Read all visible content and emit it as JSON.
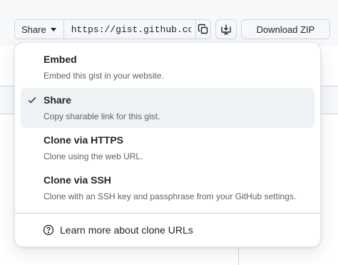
{
  "toolbar": {
    "share_label": "Share",
    "url_value": "https://gist.github.com/",
    "download_zip_label": "Download ZIP"
  },
  "menu": {
    "items": [
      {
        "title": "Embed",
        "description": "Embed this gist in your website.",
        "selected": false
      },
      {
        "title": "Share",
        "description": "Copy sharable link for this gist.",
        "selected": true
      },
      {
        "title": "Clone via HTTPS",
        "description": "Clone using the web URL.",
        "selected": false
      },
      {
        "title": "Clone via SSH",
        "description": "Clone with an SSH key and passphrase from your GitHub settings.",
        "selected": false
      }
    ],
    "footer_label": "Learn more about clone URLs"
  },
  "icons": {
    "copy": "copy-icon",
    "desktop": "desktop-download-icon",
    "check": "check-icon",
    "help": "question-circle-icon"
  },
  "colors": {
    "selected_bg": "#eff2f5",
    "muted_text": "#59636e",
    "border": "#d0d7de"
  }
}
